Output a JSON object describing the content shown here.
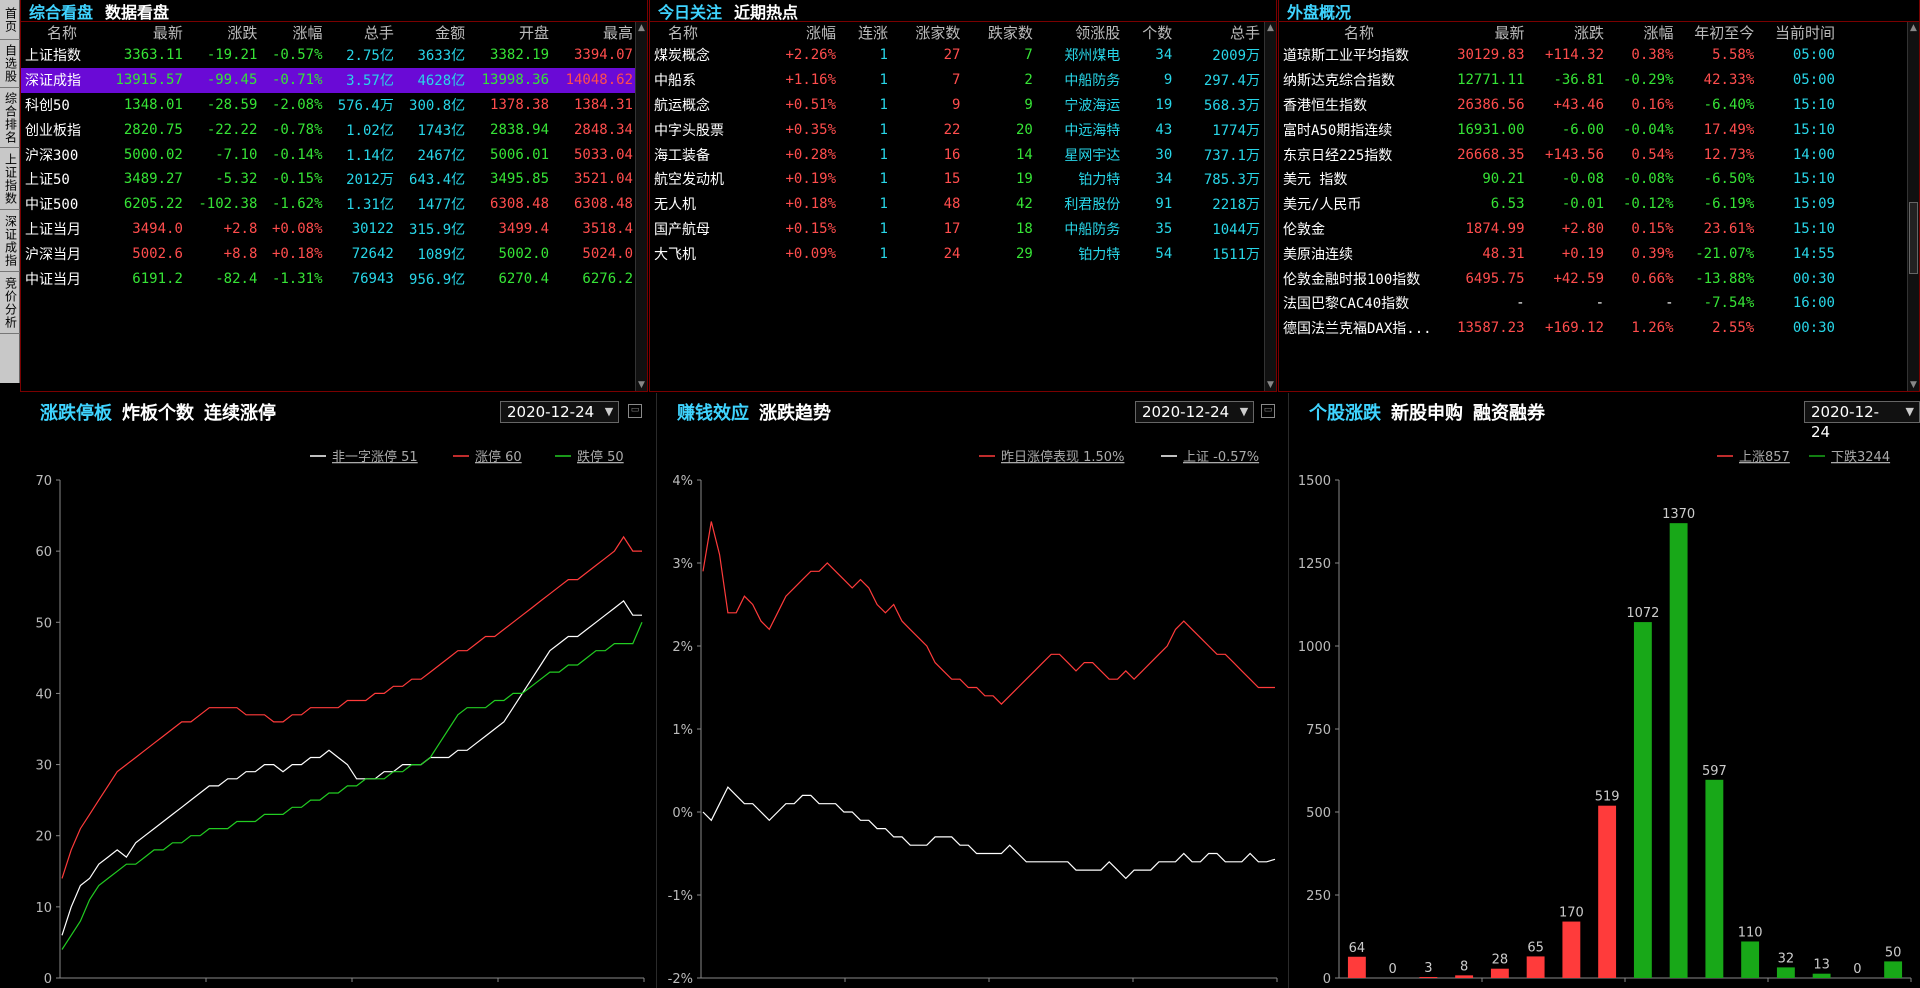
{
  "side_tabs": [
    "首页",
    "自选股",
    "综合排名",
    "上证指数",
    "深证成指",
    "竞价分析"
  ],
  "market_panel": {
    "tabs": [
      "综合看盘",
      "数据看盘"
    ],
    "columns": [
      "名称",
      "最新",
      "涨跌",
      "涨幅",
      "总手",
      "金额",
      "开盘",
      "最高"
    ],
    "rows": [
      {
        "name": "上证指数",
        "last": "3363.11",
        "chg": "-19.21",
        "pct": "-0.57%",
        "vol": "2.75亿",
        "amt": "3633亿",
        "open": "3382.19",
        "high": "3394.07",
        "dir": "down",
        "ohigh": "down",
        "hhigh": "up"
      },
      {
        "name": "深证成指",
        "last": "13915.57",
        "chg": "-99.45",
        "pct": "-0.71%",
        "vol": "3.57亿",
        "amt": "4628亿",
        "open": "13998.36",
        "high": "14048.62",
        "dir": "down",
        "ohigh": "down",
        "hhigh": "up",
        "selected": true
      },
      {
        "name": "科创50",
        "last": "1348.01",
        "chg": "-28.59",
        "pct": "-2.08%",
        "vol": "576.4万",
        "amt": "300.8亿",
        "open": "1378.38",
        "high": "1384.31",
        "dir": "down",
        "ohigh": "up",
        "hhigh": "up"
      },
      {
        "name": "创业板指",
        "last": "2820.75",
        "chg": "-22.22",
        "pct": "-0.78%",
        "vol": "1.02亿",
        "amt": "1743亿",
        "open": "2838.94",
        "high": "2848.34",
        "dir": "down",
        "ohigh": "down",
        "hhigh": "up"
      },
      {
        "name": "沪深300",
        "last": "5000.02",
        "chg": "-7.10",
        "pct": "-0.14%",
        "vol": "1.14亿",
        "amt": "2467亿",
        "open": "5006.01",
        "high": "5033.04",
        "dir": "down",
        "ohigh": "down",
        "hhigh": "up"
      },
      {
        "name": "上证50",
        "last": "3489.27",
        "chg": "-5.32",
        "pct": "-0.15%",
        "vol": "2012万",
        "amt": "643.4亿",
        "open": "3495.85",
        "high": "3521.04",
        "dir": "down",
        "ohigh": "down",
        "hhigh": "up"
      },
      {
        "name": "中证500",
        "last": "6205.22",
        "chg": "-102.38",
        "pct": "-1.62%",
        "vol": "1.31亿",
        "amt": "1477亿",
        "open": "6308.48",
        "high": "6308.48",
        "dir": "down",
        "ohigh": "up",
        "hhigh": "up"
      },
      {
        "name": "上证当月",
        "last": "3494.0",
        "chg": "+2.8",
        "pct": "+0.08%",
        "vol": "30122",
        "amt": "315.9亿",
        "open": "3499.4",
        "high": "3518.4",
        "dir": "up",
        "ohigh": "up",
        "hhigh": "up"
      },
      {
        "name": "沪深当月",
        "last": "5002.6",
        "chg": "+8.8",
        "pct": "+0.18%",
        "vol": "72642",
        "amt": "1089亿",
        "open": "5002.0",
        "high": "5024.0",
        "dir": "up",
        "ohigh": "down",
        "hhigh": "up"
      },
      {
        "name": "中证当月",
        "last": "6191.2",
        "chg": "-82.4",
        "pct": "-1.31%",
        "vol": "76943",
        "amt": "956.9亿",
        "open": "6270.4",
        "high": "6276.2",
        "dir": "down",
        "ohigh": "down",
        "hhigh": "down"
      }
    ]
  },
  "hot_panel": {
    "tabs": [
      "今日关注",
      "近期热点"
    ],
    "columns": [
      "名称",
      "涨幅",
      "连涨",
      "涨家数",
      "跌家数",
      "领涨股",
      "个数",
      "总手"
    ],
    "rows": [
      {
        "name": "煤炭概念",
        "pct": "+2.26%",
        "streak": "1",
        "up": "27",
        "down": "7",
        "leader": "郑州煤电",
        "count": "34",
        "vol": "2009万"
      },
      {
        "name": "中船系",
        "pct": "+1.16%",
        "streak": "1",
        "up": "7",
        "down": "2",
        "leader": "中船防务",
        "count": "9",
        "vol": "297.4万"
      },
      {
        "name": "航运概念",
        "pct": "+0.51%",
        "streak": "1",
        "up": "9",
        "down": "9",
        "leader": "宁波海运",
        "count": "19",
        "vol": "568.3万"
      },
      {
        "name": "中字头股票",
        "pct": "+0.35%",
        "streak": "1",
        "up": "22",
        "down": "20",
        "leader": "中远海特",
        "count": "43",
        "vol": "1774万"
      },
      {
        "name": "海工装备",
        "pct": "+0.28%",
        "streak": "1",
        "up": "16",
        "down": "14",
        "leader": "星网宇达",
        "count": "30",
        "vol": "737.1万"
      },
      {
        "name": "航空发动机",
        "pct": "+0.19%",
        "streak": "1",
        "up": "15",
        "down": "19",
        "leader": "铂力特",
        "count": "34",
        "vol": "785.3万"
      },
      {
        "name": "无人机",
        "pct": "+0.18%",
        "streak": "1",
        "up": "48",
        "down": "42",
        "leader": "利君股份",
        "count": "91",
        "vol": "2218万"
      },
      {
        "name": "国产航母",
        "pct": "+0.15%",
        "streak": "1",
        "up": "17",
        "down": "18",
        "leader": "中船防务",
        "count": "35",
        "vol": "1044万"
      },
      {
        "name": "大飞机",
        "pct": "+0.09%",
        "streak": "1",
        "up": "24",
        "down": "29",
        "leader": "铂力特",
        "count": "54",
        "vol": "1511万"
      }
    ]
  },
  "foreign_panel": {
    "tabs": [
      "外盘概况"
    ],
    "columns": [
      "名称",
      "最新",
      "涨跌",
      "涨幅",
      "年初至今",
      "当前时间"
    ],
    "rows": [
      {
        "name": "道琼斯工业平均指数",
        "last": "30129.83",
        "chg": "+114.32",
        "pct": "0.38%",
        "ytd": "5.58%",
        "time": "05:00",
        "dir": "up",
        "ydir": "up"
      },
      {
        "name": "纳斯达克综合指数",
        "last": "12771.11",
        "chg": "-36.81",
        "pct": "-0.29%",
        "ytd": "42.33%",
        "time": "05:00",
        "dir": "down",
        "ydir": "up"
      },
      {
        "name": "香港恒生指数",
        "last": "26386.56",
        "chg": "+43.46",
        "pct": "0.16%",
        "ytd": "-6.40%",
        "time": "15:10",
        "dir": "up",
        "ydir": "down"
      },
      {
        "name": "富时A50期指连续",
        "last": "16931.00",
        "chg": "-6.00",
        "pct": "-0.04%",
        "ytd": "17.49%",
        "time": "15:10",
        "dir": "down",
        "ydir": "up"
      },
      {
        "name": "东京日经225指数",
        "last": "26668.35",
        "chg": "+143.56",
        "pct": "0.54%",
        "ytd": "12.73%",
        "time": "14:00",
        "dir": "up",
        "ydir": "up"
      },
      {
        "name": "美元 指数",
        "last": "90.21",
        "chg": "-0.08",
        "pct": "-0.08%",
        "ytd": "-6.50%",
        "time": "15:10",
        "dir": "down",
        "ydir": "down"
      },
      {
        "name": "美元/人民币",
        "last": "6.53",
        "chg": "-0.01",
        "pct": "-0.12%",
        "ytd": "-6.19%",
        "time": "15:09",
        "dir": "down",
        "ydir": "down"
      },
      {
        "name": "伦敦金",
        "last": "1874.99",
        "chg": "+2.80",
        "pct": "0.15%",
        "ytd": "23.61%",
        "time": "15:10",
        "dir": "up",
        "ydir": "up"
      },
      {
        "name": "美原油连续",
        "last": "48.31",
        "chg": "+0.19",
        "pct": "0.39%",
        "ytd": "-21.07%",
        "time": "14:55",
        "dir": "up",
        "ydir": "down"
      },
      {
        "name": "伦敦金融时报100指数",
        "last": "6495.75",
        "chg": "+42.59",
        "pct": "0.66%",
        "ytd": "-13.88%",
        "time": "00:30",
        "dir": "up",
        "ydir": "down"
      },
      {
        "name": "法国巴黎CAC40指数",
        "last": "-",
        "chg": "-",
        "pct": "-",
        "ytd": "-7.54%",
        "time": "16:00",
        "dir": "none",
        "ydir": "down"
      },
      {
        "name": "德国法兰克福DAX指...",
        "last": "13587.23",
        "chg": "+169.12",
        "pct": "1.26%",
        "ytd": "2.55%",
        "time": "00:30",
        "dir": "up",
        "ydir": "up"
      }
    ]
  },
  "limit_panel": {
    "tabs": [
      "涨跌停板",
      "炸板个数",
      "连续涨停"
    ],
    "date": "2020-12-24",
    "legend": [
      "非一字涨停 51",
      "涨停 60",
      "跌停 50"
    ]
  },
  "money_panel": {
    "tabs": [
      "赚钱效应",
      "涨跌趋势"
    ],
    "date": "2020-12-24",
    "legend": [
      "昨日涨停表现 1.50%",
      "上证 -0.57%"
    ]
  },
  "stock_panel": {
    "tabs": [
      "个股涨跌",
      "新股申购",
      "融资融券"
    ],
    "date": "2020-12-24",
    "legend": [
      "上涨857",
      "下跌3244"
    ]
  },
  "colors": {
    "up": "#ff3b3b",
    "down": "#18a818",
    "white": "#ffffff",
    "accent": "#3fd4ff",
    "frame": "#7a0000"
  },
  "chart_data": [
    {
      "type": "line",
      "yticks": [
        "0",
        "10",
        "20",
        "30",
        "40",
        "50",
        "60",
        "70"
      ],
      "ylim": [
        0,
        70
      ],
      "series": [
        {
          "name": "非一字涨停",
          "color": "#ffffff",
          "values": [
            6,
            10,
            13,
            14,
            16,
            17,
            18,
            17,
            19,
            20,
            21,
            22,
            23,
            24,
            25,
            26,
            27,
            27,
            28,
            28,
            29,
            29,
            30,
            30,
            29,
            30,
            30,
            31,
            31,
            32,
            31,
            30,
            28,
            28,
            28,
            29,
            29,
            30,
            30,
            30,
            31,
            31,
            31,
            32,
            32,
            33,
            34,
            35,
            36,
            38,
            40,
            42,
            44,
            46,
            47,
            48,
            48,
            49,
            50,
            51,
            52,
            53,
            51,
            51
          ]
        },
        {
          "name": "涨停",
          "color": "#ff3b3b",
          "values": [
            14,
            18,
            21,
            23,
            25,
            27,
            29,
            30,
            31,
            32,
            33,
            34,
            35,
            36,
            36,
            37,
            38,
            38,
            38,
            38,
            37,
            37,
            37,
            36,
            36,
            37,
            37,
            38,
            38,
            38,
            38,
            39,
            39,
            39,
            40,
            40,
            41,
            41,
            42,
            42,
            43,
            44,
            45,
            46,
            46,
            47,
            48,
            48,
            49,
            50,
            51,
            52,
            53,
            54,
            55,
            56,
            56,
            57,
            58,
            59,
            60,
            62,
            60,
            60
          ]
        },
        {
          "name": "跌停",
          "color": "#22cc22",
          "values": [
            4,
            6,
            8,
            11,
            13,
            14,
            15,
            16,
            16,
            17,
            18,
            18,
            19,
            19,
            20,
            20,
            21,
            21,
            21,
            22,
            22,
            22,
            23,
            23,
            23,
            24,
            24,
            25,
            25,
            26,
            26,
            27,
            27,
            28,
            28,
            28,
            29,
            29,
            30,
            30,
            31,
            33,
            35,
            37,
            38,
            38,
            38,
            39,
            39,
            40,
            40,
            41,
            42,
            43,
            43,
            44,
            44,
            45,
            46,
            46,
            47,
            47,
            47,
            50
          ]
        }
      ]
    },
    {
      "type": "line",
      "yticks": [
        "-2%",
        "-1%",
        "0%",
        "1%",
        "2%",
        "3%",
        "4%"
      ],
      "ylim": [
        -2,
        4
      ],
      "series": [
        {
          "name": "昨日涨停表现",
          "color": "#ff3b3b",
          "values": [
            2.9,
            3.5,
            3.1,
            2.4,
            2.4,
            2.6,
            2.5,
            2.3,
            2.2,
            2.4,
            2.6,
            2.7,
            2.8,
            2.9,
            2.9,
            3.0,
            2.9,
            2.8,
            2.7,
            2.8,
            2.7,
            2.5,
            2.4,
            2.5,
            2.3,
            2.2,
            2.1,
            2.0,
            1.8,
            1.7,
            1.6,
            1.6,
            1.5,
            1.5,
            1.4,
            1.4,
            1.3,
            1.4,
            1.5,
            1.6,
            1.7,
            1.8,
            1.9,
            1.9,
            1.8,
            1.7,
            1.8,
            1.8,
            1.7,
            1.6,
            1.6,
            1.7,
            1.6,
            1.7,
            1.8,
            1.9,
            2.0,
            2.2,
            2.3,
            2.2,
            2.1,
            2.0,
            1.9,
            1.9,
            1.8,
            1.7,
            1.6,
            1.5,
            1.5,
            1.5
          ]
        },
        {
          "name": "上证",
          "color": "#ffffff",
          "values": [
            0.0,
            -0.1,
            0.1,
            0.3,
            0.2,
            0.1,
            0.1,
            0.0,
            -0.1,
            0.0,
            0.1,
            0.1,
            0.2,
            0.2,
            0.1,
            0.1,
            0.1,
            0.0,
            0.0,
            -0.1,
            -0.1,
            -0.2,
            -0.2,
            -0.3,
            -0.3,
            -0.4,
            -0.4,
            -0.4,
            -0.3,
            -0.3,
            -0.3,
            -0.4,
            -0.4,
            -0.5,
            -0.5,
            -0.5,
            -0.5,
            -0.4,
            -0.5,
            -0.6,
            -0.6,
            -0.6,
            -0.6,
            -0.6,
            -0.6,
            -0.7,
            -0.7,
            -0.7,
            -0.7,
            -0.6,
            -0.7,
            -0.8,
            -0.7,
            -0.7,
            -0.7,
            -0.6,
            -0.6,
            -0.6,
            -0.5,
            -0.6,
            -0.6,
            -0.5,
            -0.5,
            -0.6,
            -0.6,
            -0.6,
            -0.5,
            -0.6,
            -0.6,
            -0.57
          ]
        }
      ]
    },
    {
      "type": "bar",
      "yticks": [
        "0",
        "250",
        "500",
        "750",
        "1000",
        "1250",
        "1500"
      ],
      "ylim": [
        0,
        1500
      ],
      "values": [
        64,
        0,
        3,
        8,
        28,
        65,
        170,
        519,
        1072,
        1370,
        597,
        110,
        32,
        13,
        0,
        50
      ],
      "labels": [
        "64",
        "0",
        "3",
        "8",
        "28",
        "65",
        "170",
        "519",
        "1072",
        "1370",
        "597",
        "110",
        "32",
        "13",
        "0",
        "50"
      ],
      "colors": [
        "up",
        "up",
        "up",
        "up",
        "up",
        "up",
        "up",
        "up",
        "down",
        "down",
        "down",
        "down",
        "down",
        "down",
        "down",
        "down"
      ]
    }
  ]
}
